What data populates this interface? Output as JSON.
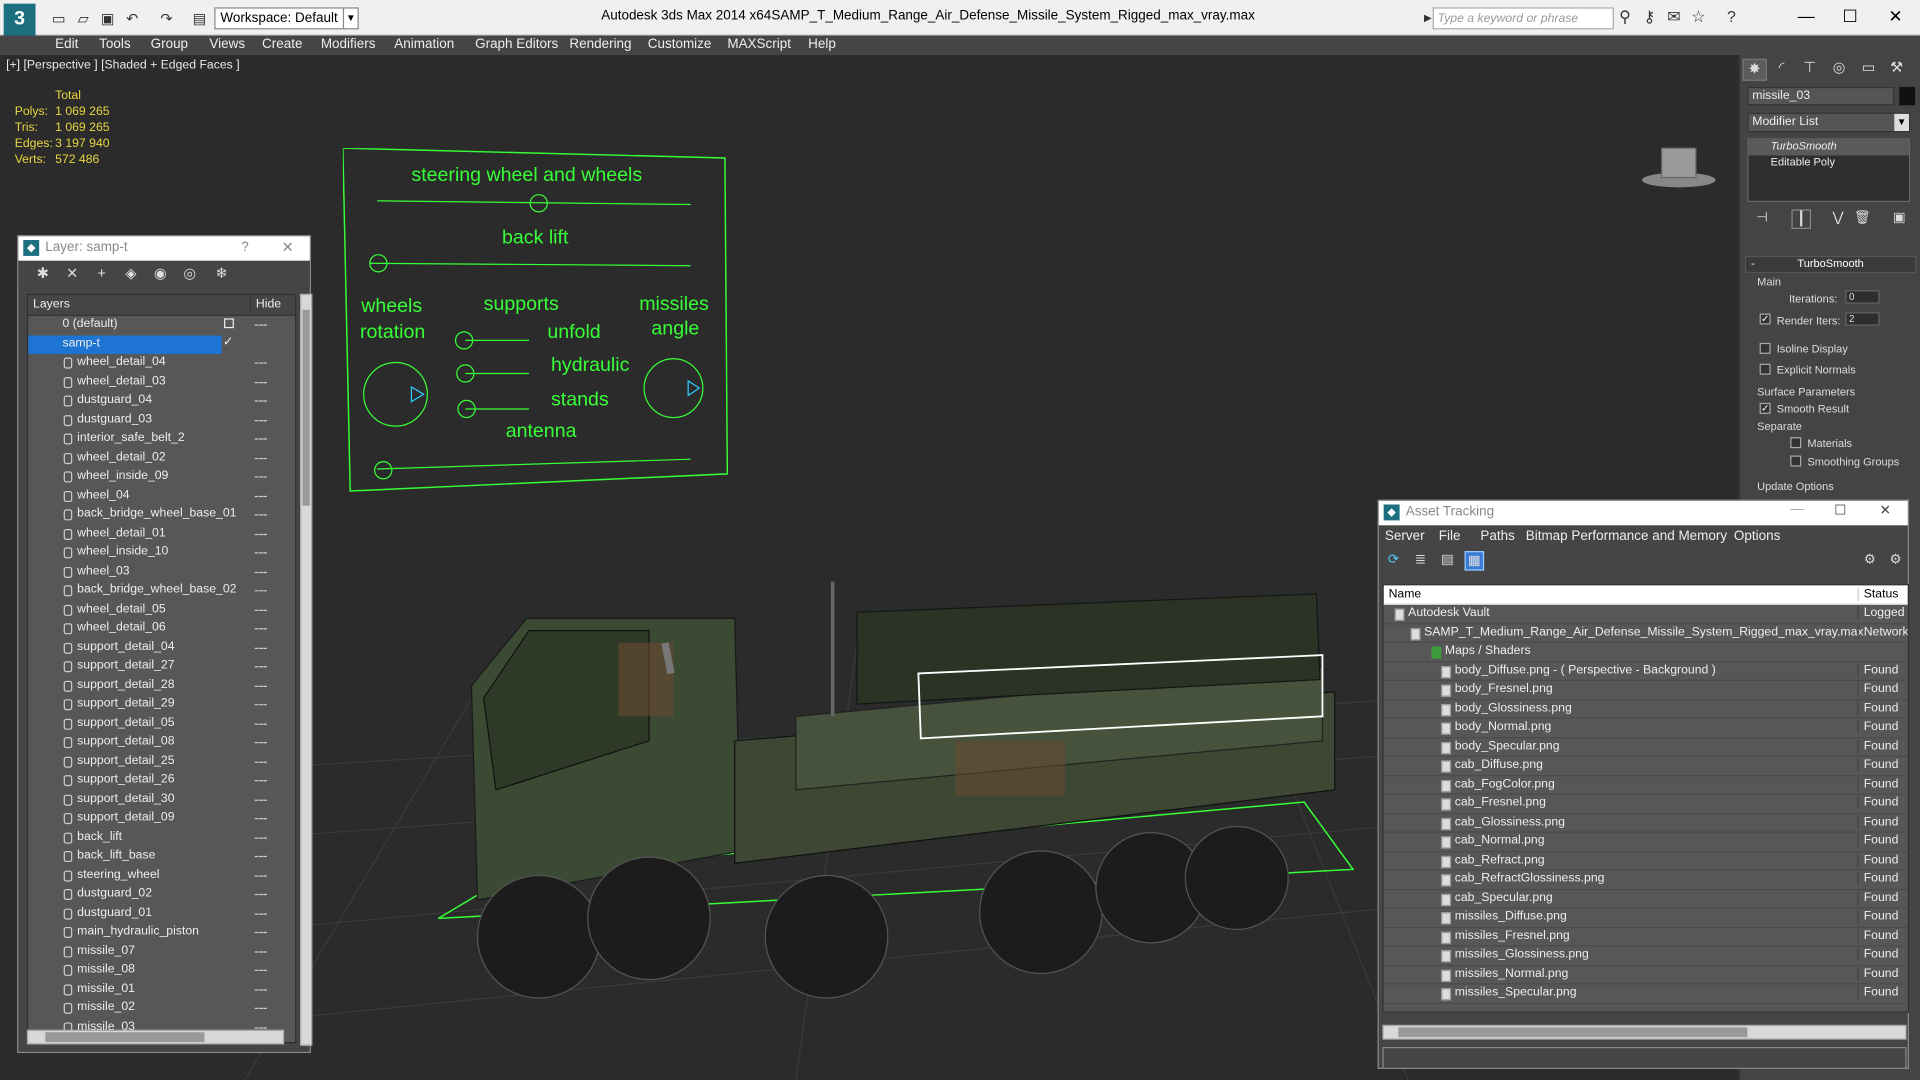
{
  "app": {
    "title": "Autodesk 3ds Max  2014 x64",
    "file": "SAMP_T_Medium_Range_Air_Defense_Missile_System_Rigged_max_vray.max",
    "workspace": "Workspace: Default",
    "search_placeholder": "Type a keyword or phrase"
  },
  "menu": [
    "Edit",
    "Tools",
    "Group",
    "Views",
    "Create",
    "Modifiers",
    "Animation",
    "Graph Editors",
    "Rendering",
    "Customize",
    "MAXScript",
    "Help"
  ],
  "viewport": {
    "label": "[+] [Perspective ] [Shaded + Edged Faces ]",
    "stats": {
      "header": "Total",
      "rows": [
        {
          "label": "Polys:",
          "value": "1 069 265"
        },
        {
          "label": "Tris:",
          "value": "1 069 265"
        },
        {
          "label": "Edges:",
          "value": "3 197 940"
        },
        {
          "label": "Verts:",
          "value": "572 486"
        }
      ]
    }
  },
  "rig_panel": {
    "steering": "steering wheel and wheels",
    "back_lift": "back lift",
    "wheels": "wheels",
    "rotation": "rotation",
    "supports": "supports",
    "missiles": "missiles",
    "angle": "angle",
    "unfold": "unfold",
    "hydraulic": "hydraulic",
    "stands": "stands",
    "antenna": "antenna"
  },
  "layer_window": {
    "title": "Layer: samp-t",
    "help": "?",
    "close": "✕",
    "col_layers": "Layers",
    "col_hide": "Hide",
    "default_layer": "0 (default)",
    "active_layer": "samp-t",
    "objects": [
      "wheel_detail_04",
      "wheel_detail_03",
      "dustguard_04",
      "dustguard_03",
      "interior_safe_belt_2",
      "wheel_detail_02",
      "wheel_inside_09",
      "wheel_04",
      "back_bridge_wheel_base_01",
      "wheel_detail_01",
      "wheel_inside_10",
      "wheel_03",
      "back_bridge_wheel_base_02",
      "wheel_detail_05",
      "wheel_detail_06",
      "support_detail_04",
      "support_detail_27",
      "support_detail_28",
      "support_detail_29",
      "support_detail_05",
      "support_detail_08",
      "support_detail_25",
      "support_detail_26",
      "support_detail_30",
      "support_detail_09",
      "back_lift",
      "back_lift_base",
      "steering_wheel",
      "dustguard_02",
      "dustguard_01",
      "main_hydraulic_piston",
      "missile_07",
      "missile_08",
      "missile_01",
      "missile_02",
      "missile_03"
    ]
  },
  "command_panel": {
    "object_name": "missile_03",
    "modifier_list": "Modifier List",
    "stack": [
      "TurboSmooth",
      "Editable Poly"
    ],
    "rollout": "TurboSmooth",
    "main": "Main",
    "iterations_label": "Iterations:",
    "iterations": "0",
    "render_iters_label": "Render Iters:",
    "render_iters": "2",
    "isoline": "Isoline Display",
    "explicit_normals": "Explicit Normals",
    "surface_params": "Surface Parameters",
    "smooth_result": "Smooth Result",
    "separate": "Separate",
    "materials": "Materials",
    "smoothing_groups": "Smoothing Groups",
    "update_options": "Update Options"
  },
  "asset_tracking": {
    "title": "Asset Tracking",
    "menu": [
      "Server",
      "File",
      "Paths",
      "Bitmap Performance and Memory",
      "Options"
    ],
    "col_name": "Name",
    "col_status": "Status",
    "rows": [
      {
        "name": "Autodesk Vault",
        "status": "Logged",
        "level": 0
      },
      {
        "name": "SAMP_T_Medium_Range_Air_Defense_Missile_System_Rigged_max_vray.max",
        "status": "Network",
        "level": 1
      },
      {
        "name": "Maps / Shaders",
        "status": "",
        "level": 2
      },
      {
        "name": "body_Diffuse.png -  ( Perspective - Background )",
        "status": "Found",
        "level": 3
      },
      {
        "name": "body_Fresnel.png",
        "status": "Found",
        "level": 3
      },
      {
        "name": "body_Glossiness.png",
        "status": "Found",
        "level": 3
      },
      {
        "name": "body_Normal.png",
        "status": "Found",
        "level": 3
      },
      {
        "name": "body_Specular.png",
        "status": "Found",
        "level": 3
      },
      {
        "name": "cab_Diffuse.png",
        "status": "Found",
        "level": 3
      },
      {
        "name": "cab_FogColor.png",
        "status": "Found",
        "level": 3
      },
      {
        "name": "cab_Fresnel.png",
        "status": "Found",
        "level": 3
      },
      {
        "name": "cab_Glossiness.png",
        "status": "Found",
        "level": 3
      },
      {
        "name": "cab_Normal.png",
        "status": "Found",
        "level": 3
      },
      {
        "name": "cab_Refract.png",
        "status": "Found",
        "level": 3
      },
      {
        "name": "cab_RefractGlossiness.png",
        "status": "Found",
        "level": 3
      },
      {
        "name": "cab_Specular.png",
        "status": "Found",
        "level": 3
      },
      {
        "name": "missiles_Diffuse.png",
        "status": "Found",
        "level": 3
      },
      {
        "name": "missiles_Fresnel.png",
        "status": "Found",
        "level": 3
      },
      {
        "name": "missiles_Glossiness.png",
        "status": "Found",
        "level": 3
      },
      {
        "name": "missiles_Normal.png",
        "status": "Found",
        "level": 3
      },
      {
        "name": "missiles_Specular.png",
        "status": "Found",
        "level": 3
      }
    ]
  },
  "colors": {
    "accent": "#1c6f7e",
    "selection": "#1e74d2",
    "rig_green": "#37ff37",
    "stats_yellow": "#e8d640"
  }
}
